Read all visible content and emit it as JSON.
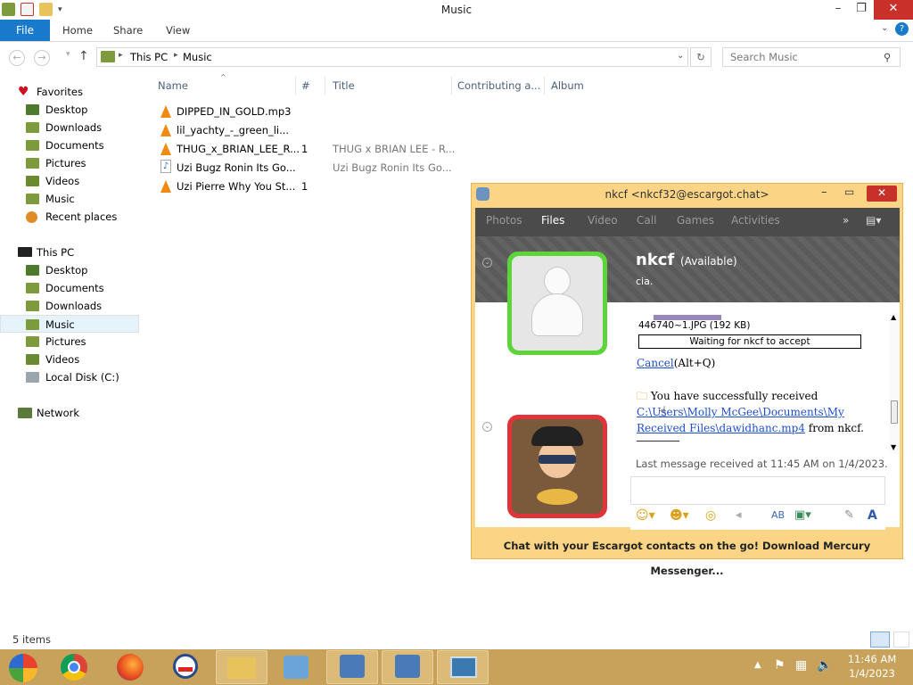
{
  "window": {
    "title": "Music"
  },
  "ribbon": {
    "file": "File",
    "tabs": [
      "Home",
      "Share",
      "View"
    ]
  },
  "address": {
    "segments": [
      "This PC",
      "Music"
    ],
    "search_placeholder": "Search Music"
  },
  "nav": {
    "favorites": {
      "label": "Favorites",
      "items": [
        "Desktop",
        "Downloads",
        "Documents",
        "Pictures",
        "Videos",
        "Music",
        "Recent places"
      ]
    },
    "this_pc": {
      "label": "This PC",
      "items": [
        "Desktop",
        "Documents",
        "Downloads",
        "Music",
        "Pictures",
        "Videos",
        "Local Disk (C:)"
      ]
    },
    "network": "Network",
    "selected": "Music"
  },
  "columns": [
    "Name",
    "#",
    "Title",
    "Contributing a...",
    "Album"
  ],
  "files": [
    {
      "name": "DIPPED_IN_GOLD.mp3",
      "num": "",
      "title": "",
      "type": "vlc"
    },
    {
      "name": "lil_yachty_-_green_li...",
      "num": "",
      "title": "",
      "type": "vlc"
    },
    {
      "name": "THUG_x_BRIAN_LEE_R...",
      "num": "1",
      "title": "THUG x BRIAN LEE - R...",
      "type": "vlc"
    },
    {
      "name": "Uzi Bugz Ronin Its Go...",
      "num": "",
      "title": "Uzi Bugz Ronin Its Go...",
      "type": "note"
    },
    {
      "name": "Uzi Pierre Why You St...",
      "num": "1",
      "title": "",
      "type": "vlc"
    }
  ],
  "status": {
    "count": "5 items"
  },
  "messenger": {
    "title": "nkcf <nkcf32@escargot.chat>",
    "tabs": [
      "Photos",
      "Files",
      "Video",
      "Call",
      "Games",
      "Activities"
    ],
    "active_tab": "Files",
    "contact": {
      "name": "nkcf",
      "status": "(Available)",
      "message": "cia."
    },
    "transfer": {
      "file": "446740~1.JPG (192 KB)",
      "waiting": "Waiting for nkcf to accept",
      "cancel": "Cancel",
      "cancel_hint": "(Alt+Q)",
      "received_prefix": "You have successfully received ",
      "received_path": "C:\\Users\\Molly McGee\\Documents\\My Received Files\\dawidhanc.mp4",
      "received_suffix": " from nkcf."
    },
    "last_message": "Last message received at 11:45 AM on 1/4/2023.",
    "footer": "Chat with your Escargot contacts on the go! Download Mercury Messenger..."
  },
  "taskbar": {
    "time": "11:46 AM",
    "date": "1/4/2023"
  },
  "colors": {
    "file_tab": "#1979ca",
    "taskbar": "#c8a25a",
    "messenger_frame": "#fbd585",
    "close": "#c7312a",
    "link": "#1f4fd0"
  }
}
